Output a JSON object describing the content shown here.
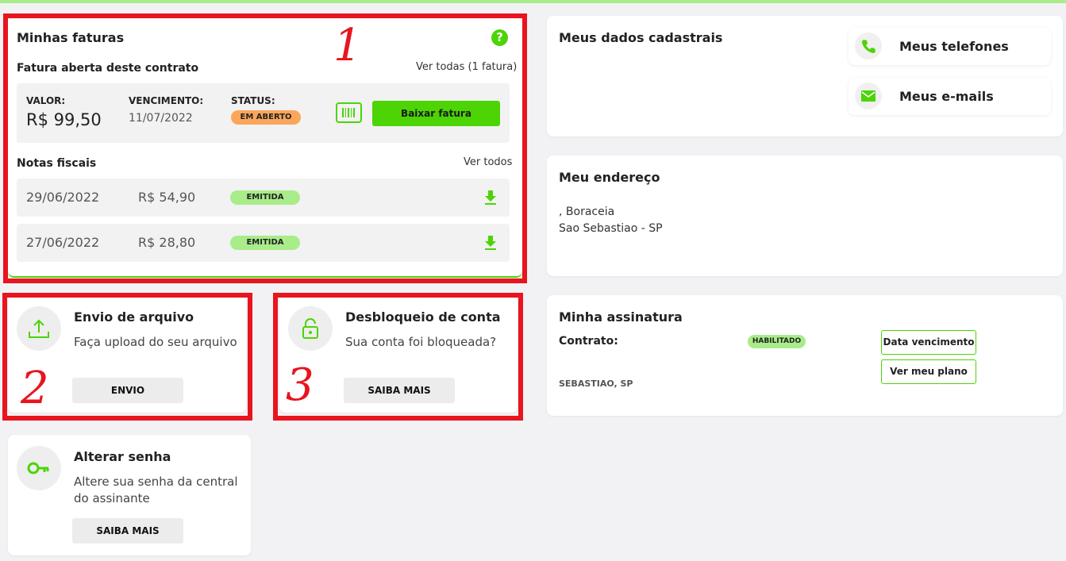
{
  "colors": {
    "accent": "#4cd405",
    "annotation": "#e8141e",
    "warning": "#fba65a",
    "emitted": "#a9ec8a"
  },
  "annotations": [
    "1",
    "2",
    "3"
  ],
  "invoices": {
    "title": "Minhas faturas",
    "help_icon": "question-icon",
    "open_invoice_title": "Fatura aberta deste contrato",
    "see_all_link": "Ver todas (1 fatura)",
    "value_label": "VALOR:",
    "value": "R$ 99,50",
    "due_label": "VENCIMENTO:",
    "due_date": "11/07/2022",
    "status_label": "STATUS:",
    "status": "EM ABERTO",
    "barcode_icon": "barcode-icon",
    "download_button": "Baixar fatura",
    "fiscal_title": "Notas fiscais",
    "fiscal_see_all": "Ver todos",
    "fiscal_notes": [
      {
        "date": "29/06/2022",
        "amount": "R$ 54,90",
        "status": "EMITIDA"
      },
      {
        "date": "27/06/2022",
        "amount": "R$ 28,80",
        "status": "EMITIDA"
      }
    ]
  },
  "upload": {
    "title": "Envio de arquivo",
    "description": "Faça upload do seu arquivo",
    "button": "ENVIO",
    "icon": "upload-icon"
  },
  "unlock": {
    "title": "Desbloqueio de conta",
    "description": "Sua conta foi bloqueada?",
    "button": "SAIBA MAIS",
    "icon": "unlock-icon"
  },
  "password": {
    "title": "Alterar senha",
    "description_line1": "Altere sua senha da central",
    "description_line2": "do assinante",
    "button": "SAIBA MAIS",
    "icon": "key-icon"
  },
  "profile": {
    "title": "Meus dados cadastrais",
    "phones_button": "Meus telefones",
    "emails_button": "Meus e-mails"
  },
  "address": {
    "title": "Meu endereço",
    "line1": ", Boraceia",
    "line2": "Sao Sebastiao - SP"
  },
  "subscription": {
    "title": "Minha assinatura",
    "contract_label": "Contrato:",
    "status": "HABILITADO",
    "location": "SEBASTIAO, SP",
    "due_button": "Data vencimento",
    "plan_button": "Ver meu plano"
  }
}
